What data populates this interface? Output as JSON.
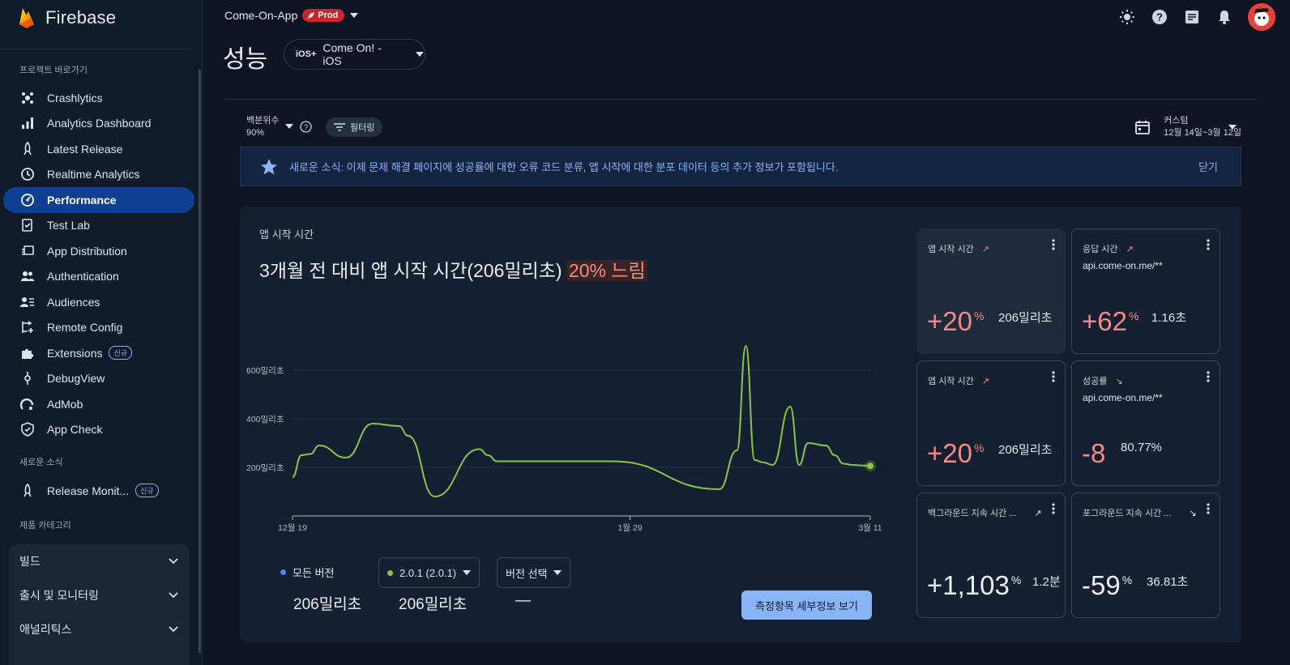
{
  "app": {
    "brand": "Firebase"
  },
  "topbar": {
    "project": "Come-On-App",
    "env_badge": "Prod"
  },
  "sidebar": {
    "shortcuts_label": "프로젝트 바로가기",
    "items": [
      {
        "label": "Crashlytics",
        "icon": "crashlytics-icon"
      },
      {
        "label": "Analytics Dashboard",
        "icon": "bar-chart-icon"
      },
      {
        "label": "Latest Release",
        "icon": "rocket-icon"
      },
      {
        "label": "Realtime Analytics",
        "icon": "clock-icon"
      },
      {
        "label": "Performance",
        "icon": "speedometer-icon",
        "active": true
      },
      {
        "label": "Test Lab",
        "icon": "checklist-icon"
      },
      {
        "label": "App Distribution",
        "icon": "app-distribution-icon"
      },
      {
        "label": "Authentication",
        "icon": "people-icon"
      },
      {
        "label": "Audiences",
        "icon": "audiences-icon"
      },
      {
        "label": "Remote Config",
        "icon": "remote-config-icon"
      },
      {
        "label": "Extensions",
        "icon": "puzzle-icon",
        "badge": "신규"
      },
      {
        "label": "DebugView",
        "icon": "debug-icon"
      },
      {
        "label": "AdMob",
        "icon": "admob-icon"
      },
      {
        "label": "App Check",
        "icon": "shield-icon"
      }
    ],
    "news_label": "새로운 소식",
    "release_item": {
      "label": "Release Monit...",
      "badge": "신규"
    },
    "category_label": "제품 카테고리",
    "accordions": [
      "빌드",
      "출시 및 모니터링",
      "애널리틱스"
    ]
  },
  "page": {
    "title": "성능",
    "app_selector": "Come On! - iOS",
    "app_platform": "iOS+",
    "percentile_label": "백분위수",
    "percentile_value": "90%",
    "filter_label": "필터링",
    "date_label": "커스텀",
    "date_range": "12월 14일~3월 12일"
  },
  "banner": {
    "text": "새로운 소식: 이제 문제 해결 페이지에 성공률에 대한 오류 코드 분류, 앱 시작에 대한 분포 데이터 등의 추가 정보가 포함됩니다.",
    "close_label": "닫기"
  },
  "card": {
    "label": "앱 시작 시간",
    "headline": "3개월 전 대비 앱 시작 시간(206밀리초)",
    "headline_highlight": "20% 느림",
    "legend": {
      "all_versions_label": "모든 버전",
      "all_versions_value": "206밀리초",
      "version_select": "2.0.1 (2.0.1)",
      "version_value": "206밀리초",
      "compare_select": "버전 선택",
      "compare_value": "—"
    },
    "detail_button": "측정항목 세부정보 보기"
  },
  "chart_data": {
    "type": "line",
    "x_tick_labels": [
      "12월 19",
      "1월 29",
      "3월 11"
    ],
    "y_tick_labels": [
      "200밀리초",
      "400밀리초",
      "600밀리초"
    ],
    "ylim": [
      0,
      700
    ],
    "grid": true,
    "series": [
      {
        "name": "2.0.1 (2.0.1)",
        "color": "#8bc34a",
        "x": [
          0,
          1,
          2,
          3,
          6,
          9,
          12,
          13,
          16,
          21,
          22,
          23,
          26,
          28,
          36,
          48,
          50,
          51,
          52,
          53,
          54,
          56,
          57,
          58,
          60,
          61,
          62,
          63,
          64,
          65
        ],
        "y": [
          160,
          250,
          255,
          290,
          240,
          380,
          370,
          330,
          80,
          275,
          250,
          225,
          225,
          225,
          225,
          110,
          270,
          700,
          230,
          220,
          210,
          450,
          210,
          300,
          290,
          250,
          215,
          210,
          208,
          206
        ]
      }
    ]
  },
  "tiles": [
    {
      "title": "앱 시작 시간",
      "subtitle": "",
      "big": "+20",
      "unit": "%",
      "value": "206밀리초",
      "trend": "up",
      "selected": true
    },
    {
      "title": "응답 시간",
      "subtitle": "api.come-on.me/**",
      "big": "+62",
      "unit": "%",
      "value": "1.16초",
      "trend": "up",
      "selected": false
    },
    {
      "title": "앱 시작 시간",
      "subtitle": "",
      "big": "+20",
      "unit": "%",
      "value": "206밀리초",
      "trend": "up",
      "selected": false
    },
    {
      "title": "성공률",
      "subtitle": "api.come-on.me/**",
      "big": "-8",
      "unit": "",
      "value": "80.77%",
      "trend": "down",
      "selected": false
    },
    {
      "title": "백그라운드 지속 시간 ...",
      "subtitle": "",
      "big": "+1,103",
      "unit": "%",
      "value": "1.2분",
      "trend": "up",
      "selected": false
    },
    {
      "title": "포그라운드 지속 시간 ...",
      "subtitle": "",
      "big": "-59",
      "unit": "%",
      "value": "36.81초",
      "trend": "down",
      "selected": false
    }
  ],
  "colors": {
    "accent": "#8ab4f8",
    "bad": "#f28b82",
    "active_nav": "#0f3f91",
    "prod_badge": "#c9252d"
  }
}
